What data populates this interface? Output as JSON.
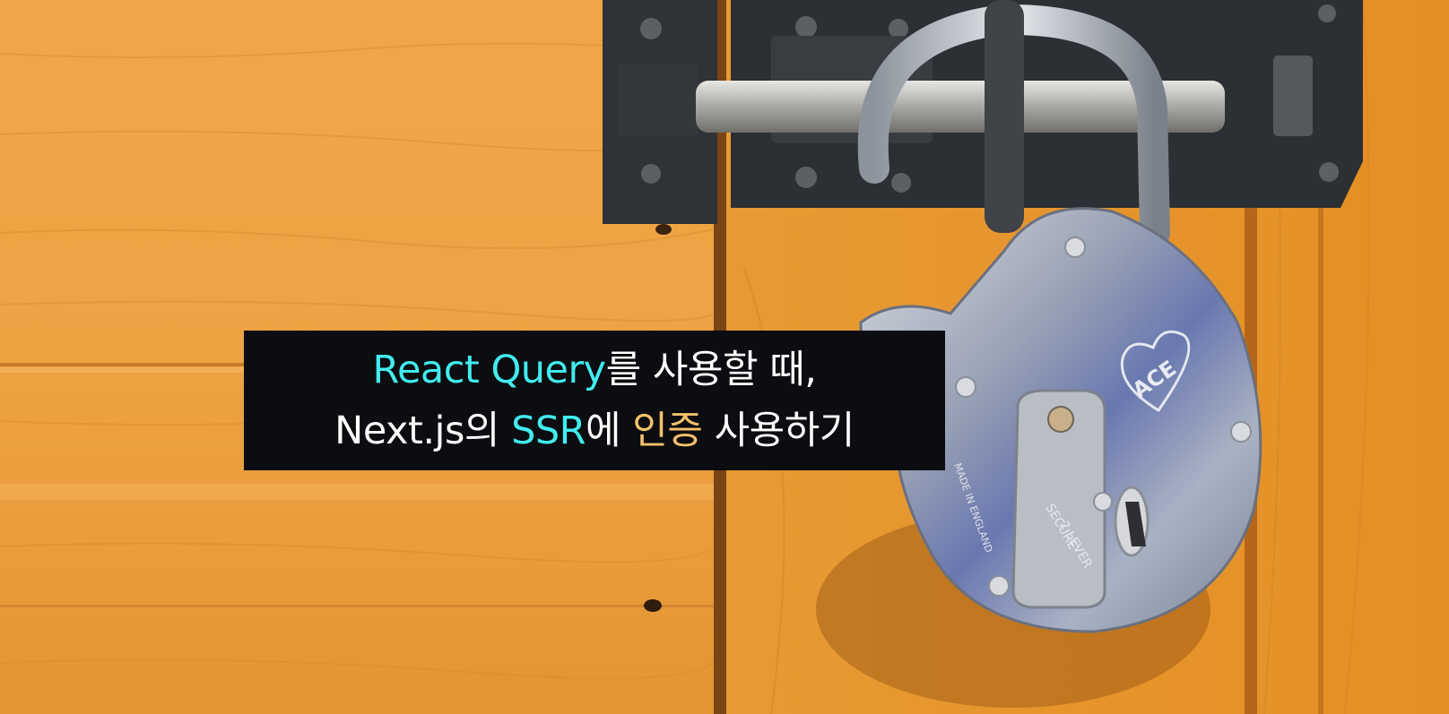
{
  "colors": {
    "wood": "#e99c3c",
    "title_background": "#0b0d10",
    "text_white": "#ffffff",
    "text_cyan": "#42ecf0",
    "text_gold": "#f3c16a"
  },
  "image": {
    "subject": "padlock-icon",
    "engraving": "ACE",
    "stamp_secure": "SECURE",
    "stamp_levers": "2 LEVER",
    "stamp_made": "MADE IN ENGLAND"
  },
  "title": {
    "line1": [
      {
        "text": "React Query",
        "color": "#42ecf0"
      },
      {
        "text": "를 사용할 때,",
        "color": "#ffffff"
      }
    ],
    "line2": [
      {
        "text": "Next.js의 ",
        "color": "#ffffff"
      },
      {
        "text": "SSR",
        "color": "#42ecf0"
      },
      {
        "text": "에 ",
        "color": "#ffffff"
      },
      {
        "text": "인증",
        "color": "#f3c16a"
      },
      {
        "text": " 사용하기",
        "color": "#ffffff"
      }
    ]
  }
}
